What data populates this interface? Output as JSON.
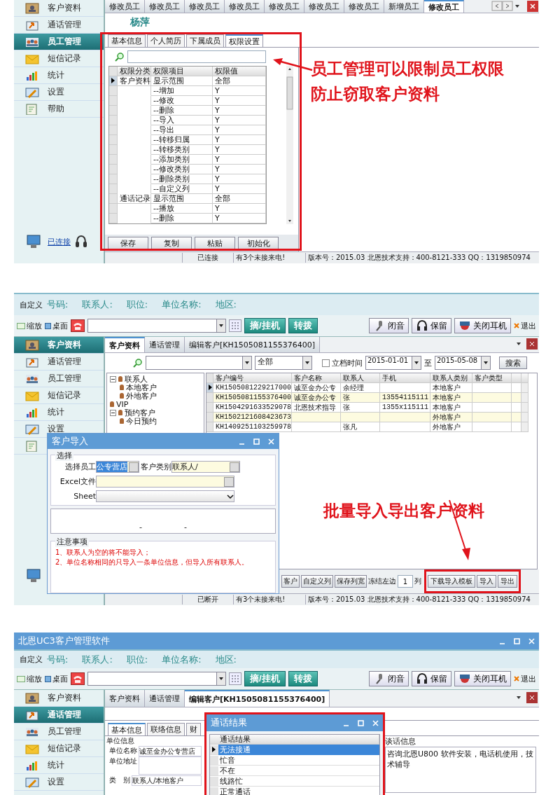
{
  "permissions_screen": {
    "sidebar": [
      {
        "label": "客户资料",
        "selected": false
      },
      {
        "label": "通话管理",
        "selected": false
      },
      {
        "label": "员工管理",
        "selected": true
      },
      {
        "label": "短信记录",
        "selected": false
      },
      {
        "label": "统计",
        "selected": false
      },
      {
        "label": "设置",
        "selected": false
      },
      {
        "label": "帮助",
        "selected": false
      }
    ],
    "connection_label": "已连接",
    "tabs": [
      {
        "label": "修改员工",
        "selected": false
      },
      {
        "label": "修改员工",
        "selected": false
      },
      {
        "label": "修改员工",
        "selected": false
      },
      {
        "label": "修改员工",
        "selected": false
      },
      {
        "label": "修改员工",
        "selected": false
      },
      {
        "label": "修改员工",
        "selected": false
      },
      {
        "label": "修改员工",
        "selected": false
      },
      {
        "label": "新增员工",
        "selected": false
      },
      {
        "label": "修改员工",
        "selected": true
      }
    ],
    "employee_name": "杨萍",
    "subtabs": [
      {
        "label": "基本信息",
        "selected": false
      },
      {
        "label": "个人简历",
        "selected": false
      },
      {
        "label": "下属成员",
        "selected": false
      },
      {
        "label": "权限设置",
        "selected": true
      }
    ],
    "grid": {
      "columns": [
        "权限分类",
        "权限项目",
        "权限值"
      ],
      "rows": [
        {
          "category": "客户资料",
          "item": "显示范围",
          "value": "全部",
          "selected": true
        },
        {
          "item": "--增加",
          "value": "Y",
          "selected": false
        },
        {
          "item": "--修改",
          "value": "Y",
          "selected": false
        },
        {
          "item": "--删除",
          "value": "Y",
          "selected": false
        },
        {
          "item": "--导入",
          "value": "Y",
          "selected": false
        },
        {
          "item": "--导出",
          "value": "Y",
          "selected": false
        },
        {
          "item": "--转移归属",
          "value": "Y",
          "selected": false
        },
        {
          "item": "--转移类别",
          "value": "Y",
          "selected": false
        },
        {
          "item": "--添加类别",
          "value": "Y",
          "selected": false
        },
        {
          "item": "--修改类别",
          "value": "Y",
          "selected": false
        },
        {
          "item": "--删除类别",
          "value": "Y",
          "selected": false
        },
        {
          "item": "--自定义列",
          "value": "Y",
          "selected": false
        },
        {
          "category": "通话记录",
          "item": "显示范围",
          "value": "全部",
          "selected": false
        },
        {
          "item": "--播放",
          "value": "Y",
          "selected": false
        },
        {
          "item": "--删除",
          "value": "Y",
          "selected": false
        }
      ]
    },
    "buttons": [
      "保存",
      "复制",
      "粘贴",
      "初始化"
    ],
    "status_bar": [
      "已连接",
      "有3个未接来电!",
      "版本号：2015.03 北恩技术支持：400-8121-333 QQ：1319850974"
    ],
    "annotation": [
      "员工管理可以限制员工权限",
      "防止窃取客户资料"
    ]
  },
  "import_screen": {
    "custom_label": "自定义",
    "search_labels": [
      "号码:",
      "联系人:",
      "职位:",
      "单位名称:",
      "地区:"
    ],
    "toolbar": {
      "zoom": "缩放",
      "desktop": "桌面",
      "call_buttons": [
        "摘/挂机",
        "转拨"
      ],
      "tool_buttons": [
        "闭音",
        "保留",
        "关闭耳机"
      ],
      "exit": "退出"
    },
    "sidebar": [
      {
        "label": "客户资料",
        "selected": true
      },
      {
        "label": "通话管理",
        "selected": false
      },
      {
        "label": "员工管理",
        "selected": false
      },
      {
        "label": "短信记录",
        "selected": false
      },
      {
        "label": "统计",
        "selected": false
      },
      {
        "label": "设置",
        "selected": false
      }
    ],
    "tabs": [
      {
        "label": "客户资料",
        "selected": true
      },
      {
        "label": "通话管理",
        "selected": false
      },
      {
        "label": "编辑客户[KH1505081155376400]",
        "selected": false
      }
    ],
    "filter": {
      "scope": "全部",
      "date_checkbox": {
        "label": "立档时间",
        "checked": false
      },
      "date_from": "2015-01-01",
      "to": "至",
      "date_to": "2015-05-08",
      "search_button": "搜索"
    },
    "tree": [
      {
        "label": "联系人",
        "expanded": true,
        "children": [
          {
            "label": "本地客户"
          },
          {
            "label": "外地客户"
          }
        ]
      },
      {
        "label": "VIP"
      },
      {
        "label": "预约客户",
        "expanded": true,
        "children": [
          {
            "label": "今日预约"
          }
        ]
      }
    ],
    "grid": {
      "columns": [
        "客户编号",
        "客户名称",
        "联系人",
        "手机",
        "联系人类别",
        "客户类型"
      ],
      "rows": [
        {
          "cells": [
            "KH1505081229217000",
            "诚至金办公专",
            "余经理",
            "",
            "本地客户",
            ""
          ],
          "selected": true
        },
        {
          "cells": [
            "KH1505081155376400",
            "诚至金办公专",
            "张",
            "13554115111",
            "本地客户",
            ""
          ],
          "selected": false
        },
        {
          "cells": [
            "KH1504291633529078",
            "北恩技术指导",
            "张",
            "1355x115111",
            "本地客户",
            ""
          ],
          "selected": false
        },
        {
          "cells": [
            "KH1502121608423673",
            "",
            "",
            "",
            "外地客户",
            ""
          ],
          "selected": false
        },
        {
          "cells": [
            "KH1409251103259978",
            "",
            "张凡",
            "",
            "外地客户",
            ""
          ],
          "selected": false
        }
      ]
    },
    "bottom_buttons": [
      "客户",
      "自定义列",
      "保存列宽"
    ],
    "freeze": {
      "label": "冻结左边",
      "value": "1",
      "unit": "列"
    },
    "template_buttons": [
      "下载导入模板",
      "导入",
      "导出"
    ],
    "status_bar": [
      "已断开",
      "有3个未接来电!",
      "版本号：2015.03 北恩技术支持：400-8121-333 QQ：1319850974"
    ],
    "dialog": {
      "title": "客户导入",
      "group": "选择",
      "employee_label": "选择员工",
      "employee_value": "公专营店",
      "type_label": "客户类别",
      "type_value": "联系人/",
      "excel_label": "Excel文件",
      "sheet_label": "Sheet",
      "progress_marks": [
        "-",
        "-"
      ],
      "notes_title": "注意事项",
      "notes": [
        "1、联系人为空的将不能导入；",
        "2、单位名称相同的只导入一条单位信息，但导入所有联系人。"
      ]
    },
    "annotation": "批量导入导出客户资料"
  },
  "call_screen": {
    "window_title": "北恩UC3客户管理软件",
    "custom_label": "自定义",
    "search_labels": [
      "号码:",
      "联系人:",
      "职位:",
      "单位名称:",
      "地区:"
    ],
    "toolbar": {
      "zoom": "缩放",
      "desktop": "桌面",
      "call_buttons": [
        "摘/挂机",
        "转拨"
      ],
      "tool_buttons": [
        "闭音",
        "保留",
        "关闭耳机"
      ],
      "exit": "退出"
    },
    "sidebar": [
      {
        "label": "客户资料",
        "selected": false
      },
      {
        "label": "通话管理",
        "selected": true
      },
      {
        "label": "员工管理",
        "selected": false
      },
      {
        "label": "短信记录",
        "selected": false
      },
      {
        "label": "统计",
        "selected": false
      },
      {
        "label": "设置",
        "selected": false
      }
    ],
    "tabs": [
      {
        "label": "客户资料",
        "selected": false
      },
      {
        "label": "通话管理",
        "selected": false
      },
      {
        "label": "编辑客户[KH1505081155376400]",
        "selected": true
      }
    ],
    "subtabs": [
      {
        "label": "基本信息",
        "selected": true
      },
      {
        "label": "联络信息",
        "selected": false
      },
      {
        "label": "财",
        "selected": false
      }
    ],
    "company_group": "单位信息",
    "fields": [
      {
        "label": "单位名称",
        "value": "诚至金办公专营店"
      },
      {
        "label": "单位地址"
      },
      {
        "label": "类　别",
        "value": "联系人/本地客户"
      }
    ],
    "talk_group": "谈话信息",
    "talk_text": "咨询北恩U800 软件安装，电话机使用，技术辅导",
    "dialog": {
      "title": "通话结果",
      "header": "通话结果",
      "items": [
        {
          "label": "无法接通",
          "selected": true
        },
        {
          "label": "忙音",
          "selected": false
        },
        {
          "label": "不在",
          "selected": false
        },
        {
          "label": "线路忙",
          "selected": false
        },
        {
          "label": "正常通话",
          "selected": false
        }
      ]
    }
  }
}
